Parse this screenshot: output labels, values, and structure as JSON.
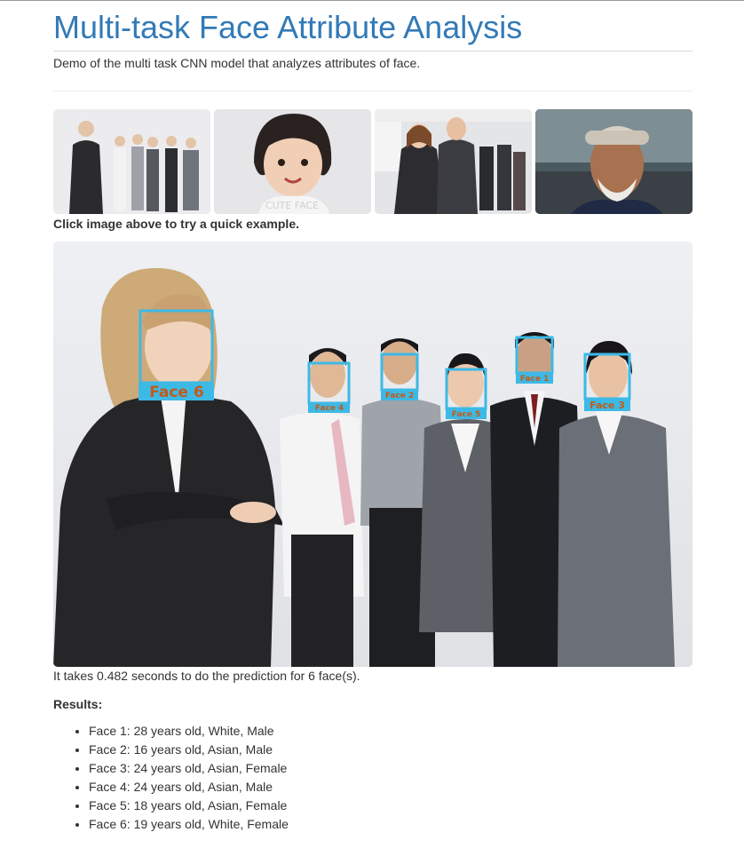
{
  "page": {
    "title": "Multi-task Face Attribute Analysis",
    "subtitle": "Demo of the multi task CNN model that analyzes attributes of face."
  },
  "examples": {
    "hint": "Click image above to try a quick example.",
    "thumbnails": [
      {
        "name": "example-group-office-1"
      },
      {
        "name": "example-child-portrait",
        "watermark": "CUTE FACE"
      },
      {
        "name": "example-business-team"
      },
      {
        "name": "example-elderly-man"
      }
    ]
  },
  "result_image": {
    "box_color": "#3db9e6",
    "faces": [
      {
        "label": "Face 1"
      },
      {
        "label": "Face 2"
      },
      {
        "label": "Face 3"
      },
      {
        "label": "Face 4"
      },
      {
        "label": "Face 5"
      },
      {
        "label": "Face 6"
      }
    ]
  },
  "prediction": {
    "timing": "It takes 0.482 seconds to do the prediction for 6 face(s)."
  },
  "results": {
    "heading": "Results:",
    "items": [
      "Face 1: 28 years old, White, Male",
      "Face 2: 16 years old, Asian, Male",
      "Face 3: 24 years old, Asian, Female",
      "Face 4: 24 years old, Asian, Male",
      "Face 5: 18 years old, Asian, Female",
      "Face 6: 19 years old, White, Female"
    ]
  }
}
